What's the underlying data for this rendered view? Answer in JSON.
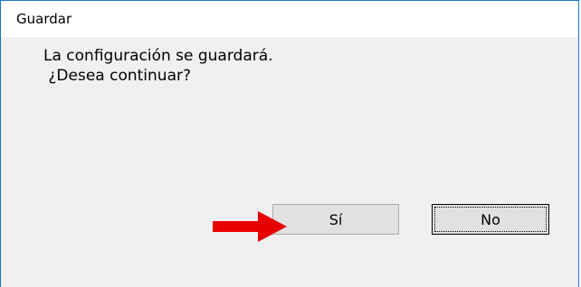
{
  "window": {
    "title": "Guardar"
  },
  "message": {
    "line1": "La configuración se guardará.",
    "line2": " ¿Desea continuar?"
  },
  "buttons": {
    "yes_label": "Sí",
    "no_label": "No"
  },
  "annotation": {
    "arrow_icon": "red-arrow-right-icon",
    "arrow_color": "#e60000"
  }
}
